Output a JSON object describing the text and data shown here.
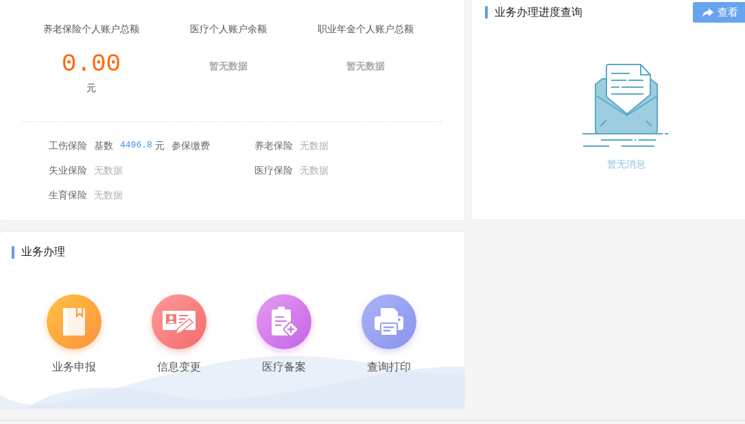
{
  "accounts": [
    {
      "label": "养老保险个人账户总额",
      "kind": "amount",
      "value": "0.00",
      "unit": "元"
    },
    {
      "label": "医疗个人账户余额",
      "kind": "empty",
      "value": "暂无数据"
    },
    {
      "label": "职业年金个人账户总额",
      "kind": "empty",
      "value": "暂无数据"
    }
  ],
  "insurance": [
    {
      "name": "工伤保险",
      "kind": "base",
      "prefix": "基数",
      "value": "4496.8",
      "unit": "元",
      "note": "参保缴费"
    },
    {
      "name": "养老保险",
      "kind": "none",
      "value": "无数据"
    },
    {
      "name": "失业保险",
      "kind": "none",
      "value": "无数据"
    },
    {
      "name": "医疗保险",
      "kind": "none",
      "value": "无数据"
    },
    {
      "name": "生育保险",
      "kind": "none",
      "value": "无数据"
    }
  ],
  "progress": {
    "title": "业务办理进度查询",
    "button": "查看",
    "empty_text": "暂无消息"
  },
  "business": {
    "title": "业务办理",
    "items": [
      {
        "label": "业务申报",
        "kind": "book"
      },
      {
        "label": "信息变更",
        "kind": "id-card"
      },
      {
        "label": "医疗备案",
        "kind": "clipboard"
      },
      {
        "label": "查询打印",
        "kind": "printer"
      }
    ]
  }
}
